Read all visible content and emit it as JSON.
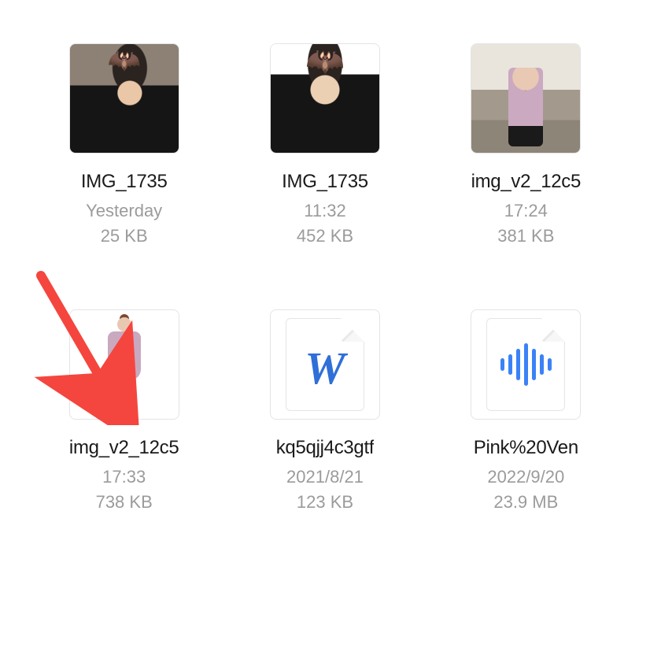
{
  "files": [
    {
      "name": "IMG_1735",
      "time": "Yesterday",
      "size": "25 KB",
      "kind": "photo-a"
    },
    {
      "name": "IMG_1735",
      "time": "11:32",
      "size": "452 KB",
      "kind": "photo-b"
    },
    {
      "name": "img_v2_12c5",
      "time": "17:24",
      "size": "381 KB",
      "kind": "photo-c"
    },
    {
      "name": "img_v2_12c5",
      "time": "17:33",
      "size": "738 KB",
      "kind": "photo-d"
    },
    {
      "name": "kq5qjj4c3gtf",
      "time": "2021/8/21",
      "size": "123 KB",
      "kind": "word"
    },
    {
      "name": "Pink%20Ven",
      "time": "2022/9/20",
      "size": "23.9 MB",
      "kind": "audio"
    }
  ],
  "annotation": {
    "arrow_color": "#f4463e"
  },
  "word_letter": "W"
}
